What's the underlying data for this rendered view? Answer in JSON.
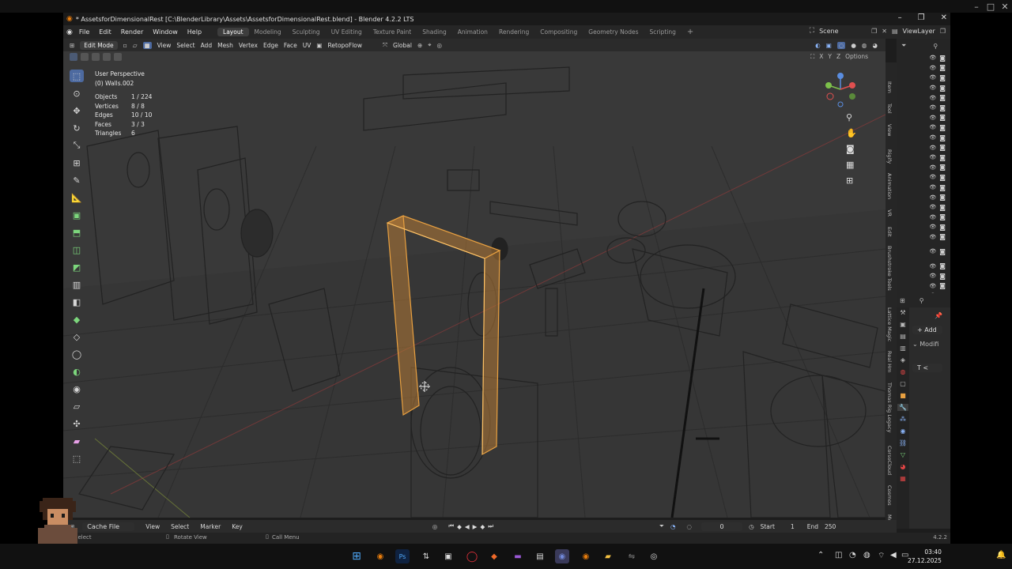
{
  "window": {
    "title": "* AssetsforDimensionalRest [C:\\BlenderLibrary\\Assets\\AssetsforDimensionalRest.blend] - Blender 4.2.2 LTS"
  },
  "menu": {
    "items": [
      "File",
      "Edit",
      "Render",
      "Window",
      "Help"
    ],
    "workspaces": [
      "Layout",
      "Modeling",
      "Sculpting",
      "UV Editing",
      "Texture Paint",
      "Shading",
      "Animation",
      "Rendering",
      "Compositing",
      "Geometry Nodes",
      "Scripting"
    ],
    "active_workspace": "Layout",
    "scene": "Scene",
    "view_layer": "ViewLayer"
  },
  "header": {
    "mode": "Edit Mode",
    "menus": [
      "View",
      "Select",
      "Add",
      "Mesh",
      "Vertex",
      "Edge",
      "Face",
      "UV"
    ],
    "addon": "RetopoFlow",
    "orientation": "Global",
    "options": "Options"
  },
  "overlay": {
    "view_name": "User Perspective",
    "object_name": "(0) Walls.002",
    "stats": [
      {
        "label": "Objects",
        "value": "1 / 224"
      },
      {
        "label": "Vertices",
        "value": "8 / 8"
      },
      {
        "label": "Edges",
        "value": "10 / 10"
      },
      {
        "label": "Faces",
        "value": "3 / 3"
      },
      {
        "label": "Triangles",
        "value": "6"
      }
    ]
  },
  "sidebar_tabs": [
    "Item",
    "Tool",
    "View",
    "Rigify",
    "Animation",
    "VR",
    "Edit",
    "Brushstroke Tools",
    "Lattice Magic",
    "Real Hm",
    "Thomas Rig Legacy",
    "CorsoCloud",
    "Cosmos",
    "Mo"
  ],
  "properties": {
    "add_modifier": "Add",
    "modifier_label": "Modifi"
  },
  "timeline": {
    "cache": "Cache File",
    "menus": [
      "View",
      "Select",
      "Marker",
      "Key"
    ],
    "current_frame": "0",
    "start_label": "Start",
    "start": "1",
    "end_label": "End",
    "end": "250"
  },
  "status": {
    "left": "Select",
    "middle": "Rotate View",
    "right": "Call Menu",
    "version": "4.2.2"
  },
  "clock": {
    "time": "03:40",
    "date": "27.12.2025"
  },
  "colors": {
    "selection": "#e8a040",
    "accent": "#4d6aa0",
    "viewport_bg": "#3a3a3a"
  }
}
